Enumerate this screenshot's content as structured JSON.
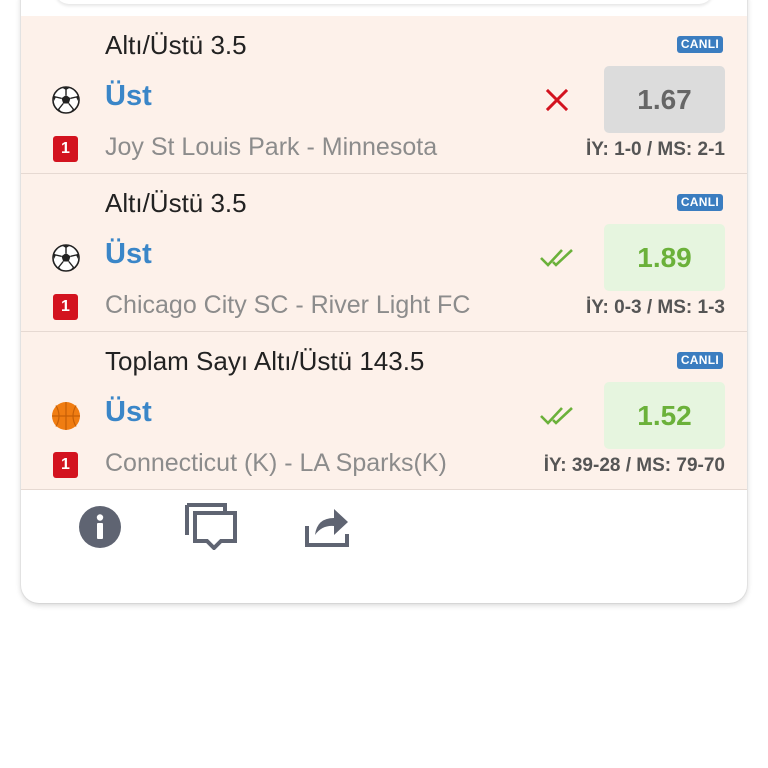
{
  "bets": [
    {
      "market": "Altı/Üstü 3.5",
      "live_badge": "CANLI",
      "sport_icon": "soccer-ball-icon",
      "pick": "Üst",
      "status": "lost",
      "status_icon": "x-mark-icon",
      "odd": "1.67",
      "red_card": "1",
      "teams": "Joy St Louis Park - Minnesota",
      "score": "İY: 1-0 / MS: 2-1"
    },
    {
      "market": "Altı/Üstü 3.5",
      "live_badge": "CANLI",
      "sport_icon": "soccer-ball-icon",
      "pick": "Üst",
      "status": "won",
      "status_icon": "double-check-icon",
      "odd": "1.89",
      "red_card": "1",
      "teams": "Chicago City SC - River Light FC",
      "score": "İY: 0-3 / MS: 1-3"
    },
    {
      "market": "Toplam Sayı Altı/Üstü 143.5",
      "live_badge": "CANLI",
      "sport_icon": "basketball-icon",
      "pick": "Üst",
      "status": "won",
      "status_icon": "double-check-icon",
      "odd": "1.52",
      "red_card": "1",
      "teams": "Connecticut (K) - LA Sparks(K)",
      "score": "İY: 39-28 / MS: 79-70"
    }
  ],
  "actions": [
    "info-icon",
    "comments-icon",
    "share-icon"
  ],
  "colors": {
    "row_bg": "#fdf1ea",
    "pick_blue": "#3a86c8",
    "live_blue": "#3b7dc0",
    "won_green": "#6bb13a",
    "lost_red": "#d3131f"
  }
}
